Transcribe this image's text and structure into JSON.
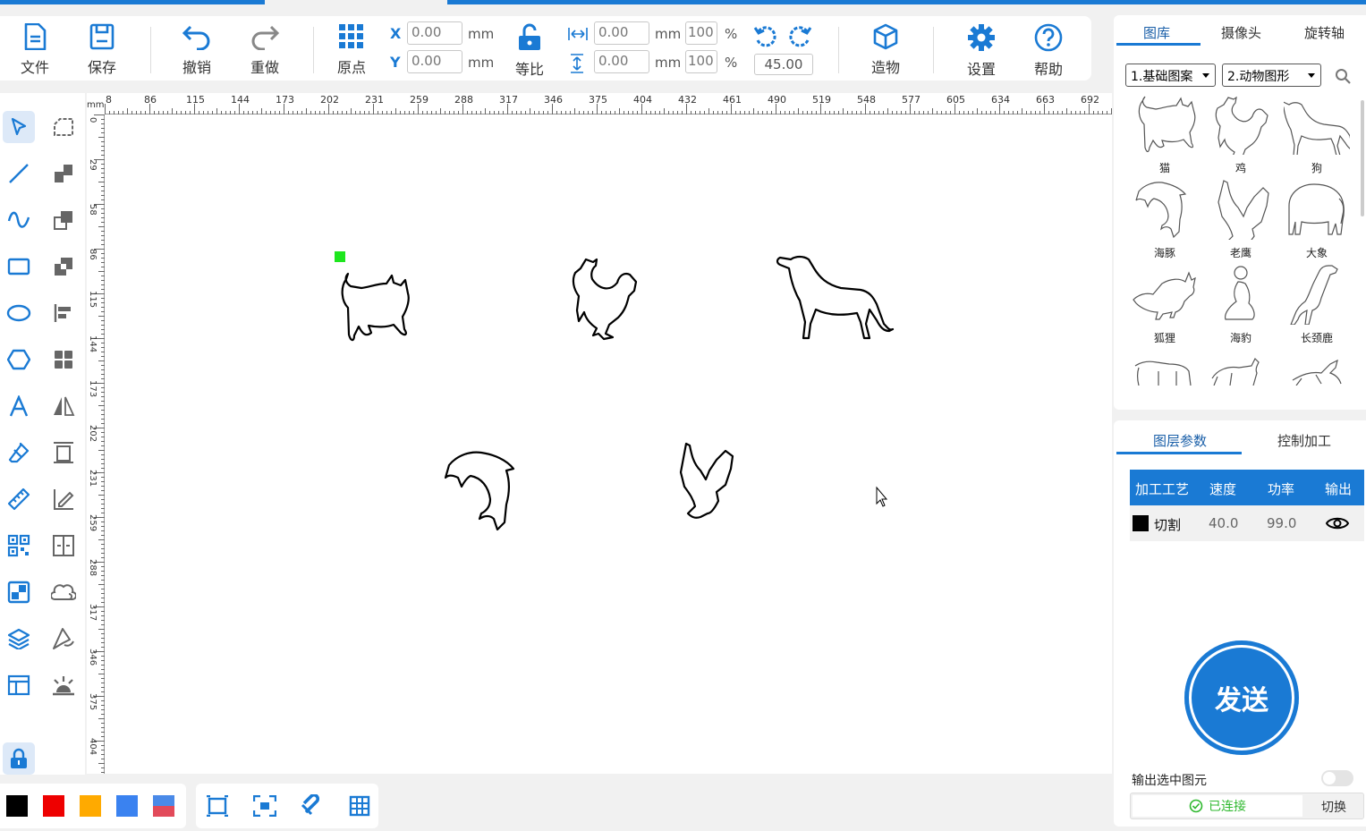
{
  "toolbar": {
    "file": "文件",
    "save": "保存",
    "undo": "撤销",
    "redo": "重做",
    "origin": "原点",
    "x_label": "X",
    "y_label": "Y",
    "x_value": "0.00",
    "y_value": "0.00",
    "unit_mm": "mm",
    "proportional": "等比",
    "width_value": "0.00",
    "height_value": "0.00",
    "width_percent": "100",
    "height_percent": "100",
    "percent_sign": "%",
    "rotate_angle": "45.00",
    "build": "造物",
    "settings": "设置",
    "help": "帮助"
  },
  "ruler": {
    "unit": "mm",
    "top_ticks": [
      "8",
      "86",
      "115",
      "144",
      "173",
      "202",
      "231",
      "259",
      "288",
      "317",
      "346",
      "375",
      "404",
      "432",
      "461",
      "490",
      "519",
      "548",
      "577",
      "605",
      "634",
      "663",
      "692"
    ],
    "left_ticks": [
      "0",
      "29",
      "58",
      "86",
      "115",
      "144",
      "173",
      "202",
      "231",
      "259",
      "288",
      "317",
      "346",
      "375",
      "404"
    ]
  },
  "colors": {
    "accent": "#1a7ad4",
    "swatches": [
      "#000000",
      "#ee0000",
      "#ffaa00",
      "#3a82f0",
      "gradient-blue-red"
    ]
  },
  "library": {
    "tabs": [
      "图库",
      "摄像头",
      "旋转轴"
    ],
    "active_tab": "图库",
    "category1": "1.基础图案",
    "category2": "2.动物图形",
    "animals": [
      "猫",
      "鸡",
      "狗",
      "海豚",
      "老鹰",
      "大象",
      "狐狸",
      "海豹",
      "长颈鹿"
    ]
  },
  "layer_panel": {
    "tabs": [
      "图层参数",
      "控制加工"
    ],
    "headers": [
      "加工工艺",
      "速度",
      "功率",
      "输出"
    ],
    "rows": [
      {
        "process": "切割",
        "speed": "40.0",
        "power": "99.0",
        "color": "#000000"
      }
    ],
    "send": "发送",
    "output_selected": "输出选中图元",
    "connected": "已连接",
    "switch": "切换"
  }
}
